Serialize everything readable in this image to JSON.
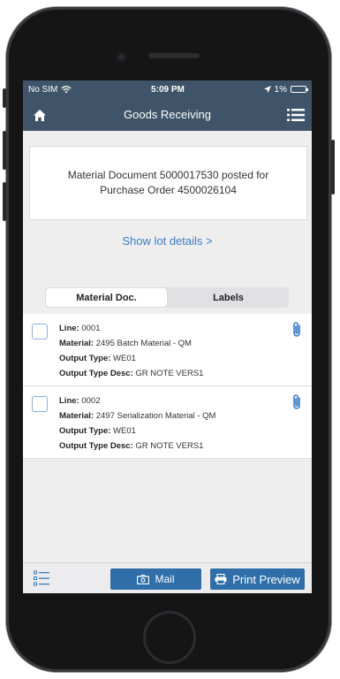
{
  "status_bar": {
    "carrier": "No SIM",
    "time": "5:09 PM",
    "battery": "1%"
  },
  "header": {
    "title": "Goods Receiving"
  },
  "message": {
    "line1": "Material Document 5000017530 posted for",
    "line2": "Purchase Order 4500026104"
  },
  "lot_link": "Show lot details >",
  "tabs": [
    {
      "label": "Material Doc.",
      "active": true
    },
    {
      "label": "Labels",
      "active": false
    }
  ],
  "rows": [
    {
      "line_label": "Line:",
      "line_value": "0001",
      "material_label": "Material:",
      "material_value": "2495 Batch Material - QM",
      "output_type_label": "Output Type:",
      "output_type_value": "WE01",
      "output_desc_label": "Output Type Desc:",
      "output_desc_value": "GR NOTE VERS1"
    },
    {
      "line_label": "Line:",
      "line_value": "0002",
      "material_label": "Material:",
      "material_value": "2497 Serialization Material - QM",
      "output_type_label": "Output Type:",
      "output_type_value": "WE01",
      "output_desc_label": "Output Type Desc:",
      "output_desc_value": "GR NOTE VERS1"
    }
  ],
  "toolbar": {
    "mail_label": "Mail",
    "print_label": "Print Preview"
  },
  "colors": {
    "header": "#3f5468",
    "link": "#3a7dc0",
    "button": "#2f6ea8"
  },
  "icons": [
    "home-icon",
    "menu-icon",
    "wifi-icon",
    "location-arrow-icon",
    "battery-icon",
    "paperclip-icon",
    "list-icon",
    "mail-icon",
    "printer-icon"
  ]
}
